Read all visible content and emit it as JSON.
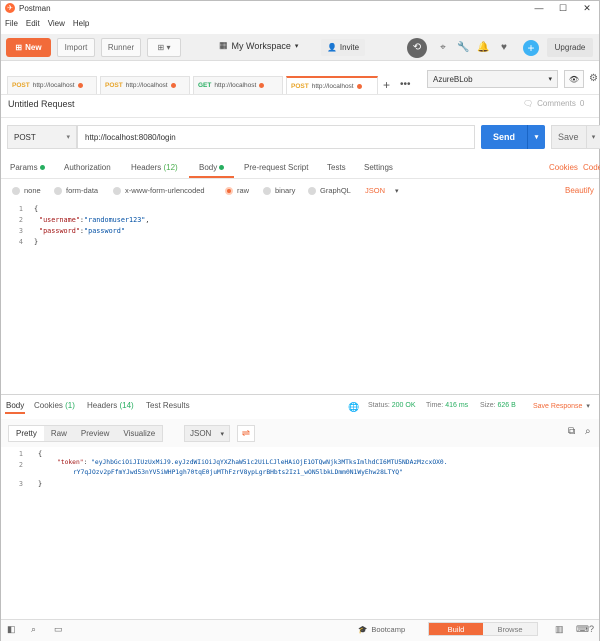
{
  "window": {
    "title": "Postman",
    "controls": [
      "—",
      "☐",
      "✕"
    ]
  },
  "menu": [
    "File",
    "Edit",
    "View",
    "Help"
  ],
  "header": {
    "new_label": "New",
    "import_label": "Import",
    "runner_label": "Runner",
    "workspace_label": "My Workspace",
    "invite_label": "Invite",
    "upgrade_label": "Upgrade"
  },
  "tabs": [
    {
      "method": "POST",
      "url": "http://localhost",
      "active": false
    },
    {
      "method": "POST",
      "url": "http://localhost",
      "active": false
    },
    {
      "method": "GET",
      "url": "http://localhost",
      "active": false
    },
    {
      "method": "POST",
      "url": "http://localhost",
      "active": true
    }
  ],
  "environment": {
    "selected": "AzureBLob"
  },
  "request": {
    "title": "Untitled Request",
    "comments_label": "Comments",
    "comments_count": "0",
    "method": "POST",
    "url": "http://localhost:8080/login",
    "send_label": "Send",
    "save_label": "Save"
  },
  "request_tabs": {
    "params": "Params",
    "authorization": "Authorization",
    "headers": "Headers",
    "headers_count": "(12)",
    "body": "Body",
    "prerequest": "Pre-request Script",
    "tests": "Tests",
    "settings": "Settings",
    "cookies": "Cookies",
    "code": "Code"
  },
  "body_types": {
    "none": "none",
    "form_data": "form-data",
    "urlencoded": "x-www-form-urlencoded",
    "raw": "raw",
    "binary": "binary",
    "graphql": "GraphQL",
    "format": "JSON",
    "beautify": "Beautify"
  },
  "request_body": {
    "lines": [
      "1",
      "2",
      "3",
      "4"
    ],
    "open": "{",
    "username_key": "\"username\"",
    "username_val": "\"randomuser123\"",
    "password_key": "\"password\"",
    "password_val": "\"password\"",
    "close": "}"
  },
  "response": {
    "tab_body": "Body",
    "tab_cookies": "Cookies",
    "cookies_count": "(1)",
    "tab_headers": "Headers",
    "headers_count": "(14)",
    "tab_tests": "Test Results",
    "status_label": "Status:",
    "status_value": "200 OK",
    "time_label": "Time:",
    "time_value": "416 ms",
    "size_label": "Size:",
    "size_value": "626 B",
    "save_response": "Save Response",
    "view_pretty": "Pretty",
    "view_raw": "Raw",
    "view_preview": "Preview",
    "view_visualize": "Visualize",
    "format": "JSON",
    "lines": [
      "1",
      "2",
      "",
      "3"
    ],
    "open": "{",
    "token_key": "\"token\"",
    "token_val_1": "\"eyJhbGciOiJIUzUxMiJ9.eyJzdWIiOiJqYXZhaW51c2UiLCJleHAiOjE1OTQwNjk3MTksImlhdCI6MTU5NDAzMzcxOX0.",
    "token_val_2": "rY7qJOzv2pFfmYJwd53nYV5iWHP1gh70tqE0juMThFzrV8ypLgrBHbts2Iz1_wON5lbkLDmm0N1WyEhw28LTYQ\"",
    "close": "}"
  },
  "footer": {
    "bootcamp": "Bootcamp",
    "build": "Build",
    "browse": "Browse"
  },
  "colors": {
    "accent": "#f26b3a",
    "send": "#2e7de1",
    "status_ok": "#27ae60"
  }
}
